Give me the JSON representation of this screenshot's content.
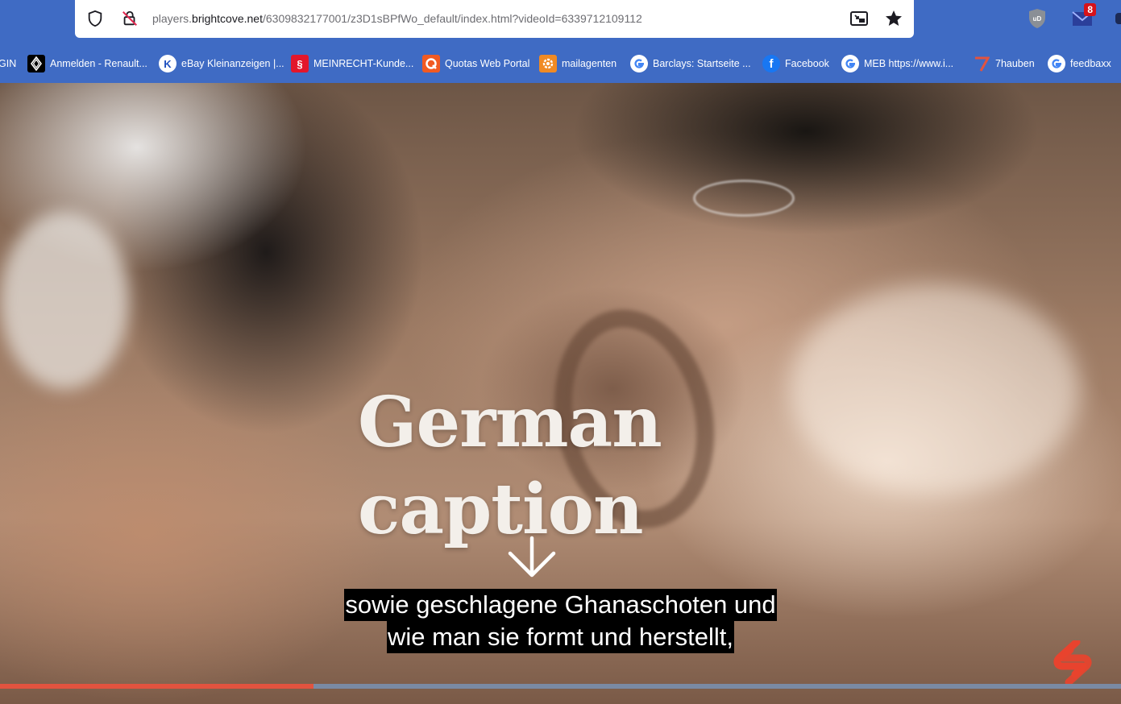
{
  "browser": {
    "url_prefix": "players.",
    "url_domain": "brightcove.net",
    "url_path": "/6309832177001/z3D1sBPfWo_default/index.html?videoId=6339712109112",
    "mail_badge_count": "8",
    "ublock_label": "uD"
  },
  "bookmarks": [
    {
      "label": "GIN",
      "icon": "truncated-bookmark",
      "color": "#3f6bc4"
    },
    {
      "label": "Anmelden - Renault...",
      "icon": "renault-logo-icon",
      "color": "#000000"
    },
    {
      "label": "eBay Kleinanzeigen |...",
      "icon": "ebay-k-icon",
      "color": "#ffffff"
    },
    {
      "label": "MEINRECHT-Kunde...",
      "icon": "paragraph-icon",
      "color": "#e3162b"
    },
    {
      "label": "Quotas Web Portal",
      "icon": "quotas-icon",
      "color": "#f15a22"
    },
    {
      "label": "mailagenten",
      "icon": "gear-orange-icon",
      "color": "#f08a24"
    },
    {
      "label": "Barclays: Startseite ...",
      "icon": "google-icon",
      "color": "#ffffff"
    },
    {
      "label": "Facebook",
      "icon": "facebook-icon",
      "color": "#1877f2"
    },
    {
      "label": "MEB  https://www.i...",
      "icon": "google-icon",
      "color": "#ffffff"
    },
    {
      "label": "7hauben",
      "icon": "7hauben-icon",
      "color": "#e2533f"
    },
    {
      "label": "feedbaxx",
      "icon": "google-icon",
      "color": "#ffffff"
    }
  ],
  "video": {
    "title_line1": "German",
    "title_line2": "caption",
    "caption_line1": "sowie geschlagene Ghanaschoten und",
    "caption_line2": "wie man sie formt und herstellt,",
    "progress_fraction": 0.28,
    "progress_color": "#e2533f",
    "track_color": "#7a8aa3"
  }
}
